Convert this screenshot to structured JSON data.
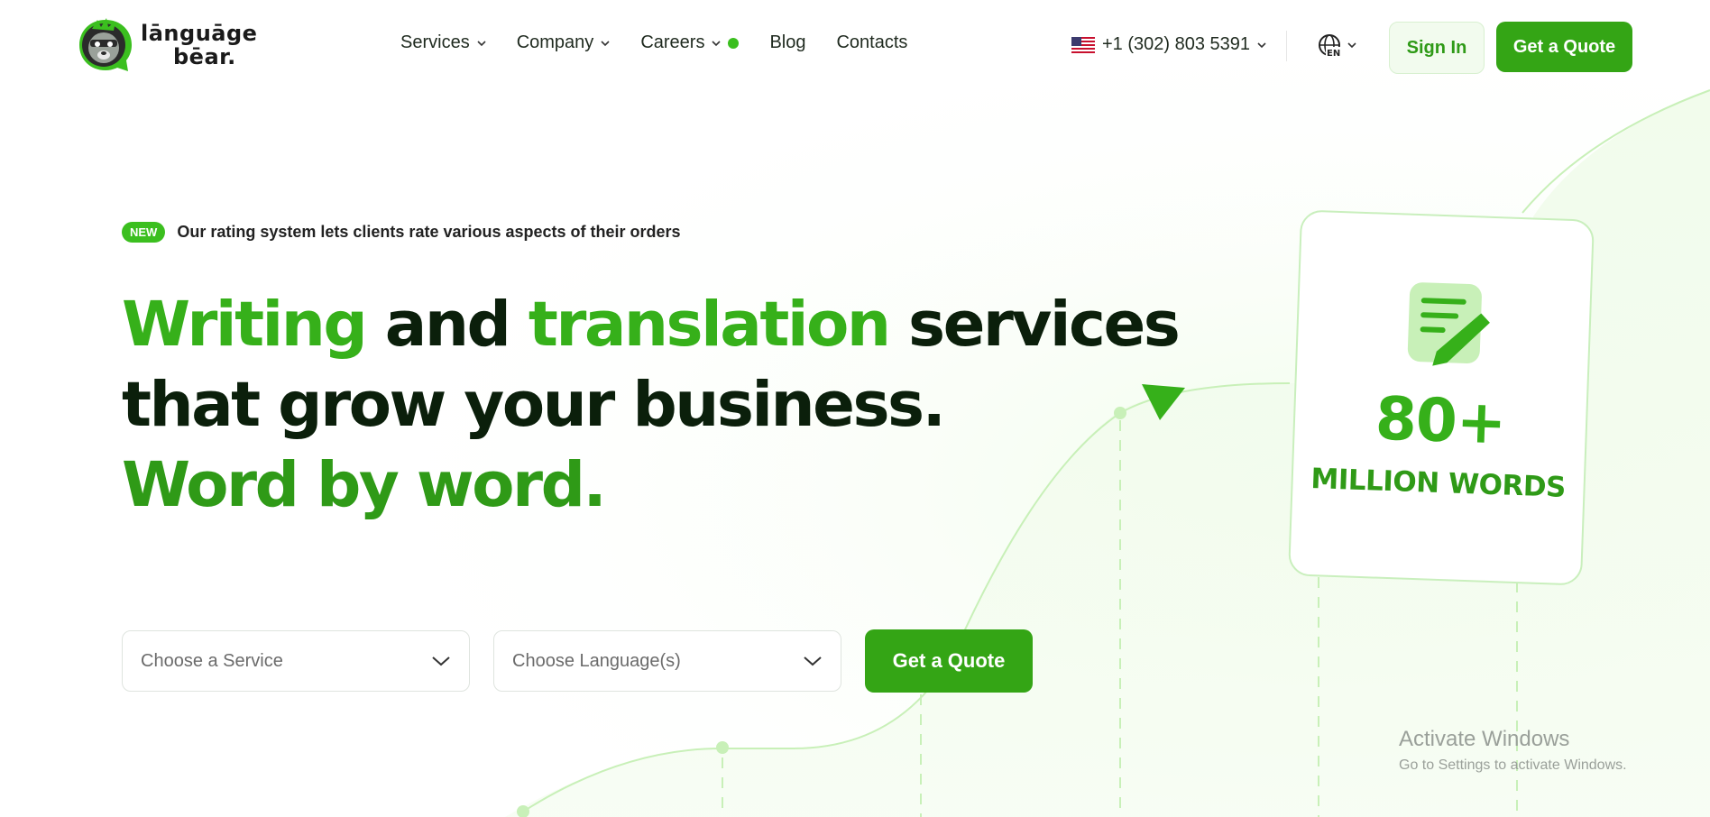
{
  "brand": {
    "line1": "lānguāge",
    "line2": "bēar."
  },
  "nav": {
    "items": [
      {
        "label": "Services"
      },
      {
        "label": "Company"
      },
      {
        "label": "Careers"
      },
      {
        "label": "Blog"
      },
      {
        "label": "Contacts"
      }
    ]
  },
  "header": {
    "phone": "+1 (302) 803 5391",
    "language_code": "EN",
    "sign_in": "Sign In",
    "get_quote": "Get a Quote"
  },
  "hero": {
    "badge": "NEW",
    "announcement": "Our rating system lets clients rate various aspects of their orders",
    "headline": {
      "word1": "Writing",
      "word2": " and ",
      "word3": "translation",
      "word4": " services",
      "line2": "that grow your business.",
      "line3": "Word by word."
    }
  },
  "form": {
    "service_placeholder": "Choose a Service",
    "language_placeholder": "Choose Language(s)",
    "submit": "Get a Quote"
  },
  "stat": {
    "number": "80+",
    "label": "MILLION WORDS"
  },
  "watermark": {
    "title": "Activate Windows",
    "subtitle": "Go to Settings to activate Windows."
  },
  "colors": {
    "brand_green": "#34a515",
    "accent_green": "#36b01a",
    "dark": "#0b1f0b"
  }
}
